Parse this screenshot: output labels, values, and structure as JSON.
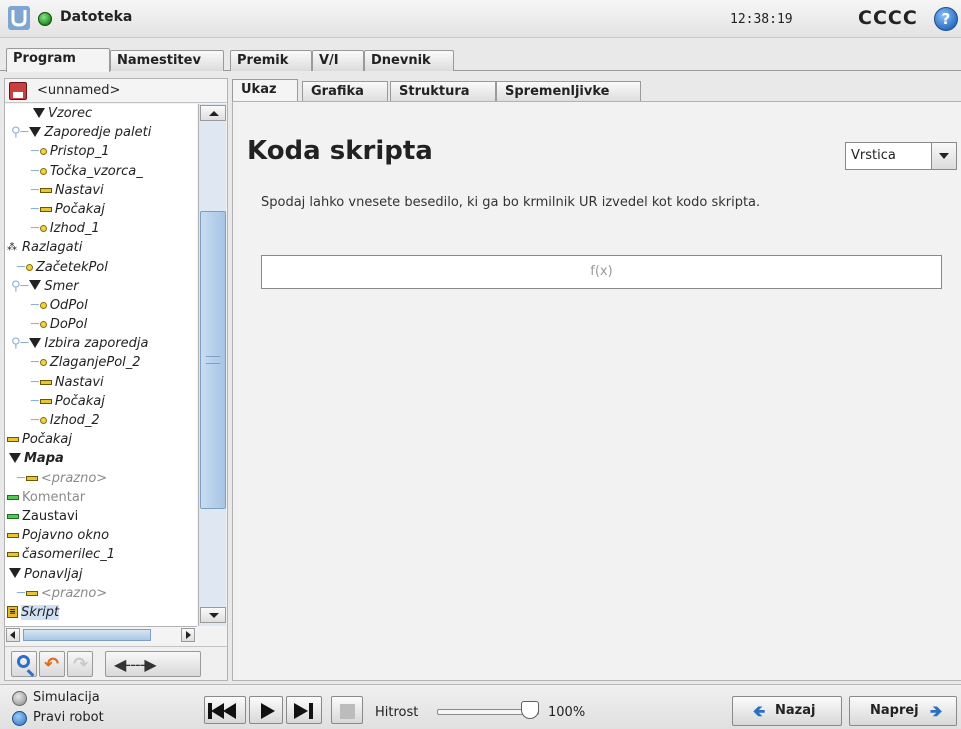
{
  "topbar": {
    "file_label": "Datoteka",
    "clock": "12:38:19",
    "robot_name": "CCCC",
    "help_glyph": "?"
  },
  "main_tabs": [
    "Program",
    "Namestitev",
    "Premik",
    "V/I",
    "Dnevnik"
  ],
  "program": {
    "name": "<unnamed>"
  },
  "tree": [
    {
      "label": "Vzorec",
      "icon": "triangle"
    },
    {
      "label": "Zaporedje paleti",
      "icon": "triangle"
    },
    {
      "label": "Pristop_1",
      "icon": "waypoint"
    },
    {
      "label": "Točka_vzorca_",
      "icon": "waypoint"
    },
    {
      "label": "Nastavi",
      "icon": "bar"
    },
    {
      "label": "Počakaj",
      "icon": "bar"
    },
    {
      "label": "Izhod_1",
      "icon": "waypoint"
    },
    {
      "label": "Razlagati",
      "icon": "pallet"
    },
    {
      "label": "ZačetekPol",
      "icon": "waypoint"
    },
    {
      "label": "Smer",
      "icon": "triangle"
    },
    {
      "label": "OdPol",
      "icon": "waypoint"
    },
    {
      "label": "DoPol",
      "icon": "waypoint"
    },
    {
      "label": "Izbira zaporedja",
      "icon": "triangle"
    },
    {
      "label": "ZlaganjePol_2",
      "icon": "waypoint"
    },
    {
      "label": "Nastavi",
      "icon": "bar"
    },
    {
      "label": "Počakaj",
      "icon": "bar"
    },
    {
      "label": "Izhod_2",
      "icon": "waypoint"
    },
    {
      "label": "Počakaj",
      "icon": "bar"
    },
    {
      "label": "Mapa",
      "icon": "triangle"
    },
    {
      "label": "<prazno>",
      "icon": "bar"
    },
    {
      "label": "Komentar",
      "icon": "bar-green"
    },
    {
      "label": "Zaustavi",
      "icon": "bar-green"
    },
    {
      "label": "Pojavno okno",
      "icon": "bar"
    },
    {
      "label": "časomerilec_1",
      "icon": "bar"
    },
    {
      "label": "Ponavljaj",
      "icon": "triangle"
    },
    {
      "label": "<prazno>",
      "icon": "bar"
    },
    {
      "label": "Skript",
      "icon": "script"
    }
  ],
  "sub_tabs": [
    "Ukaz",
    "Grafika",
    "Struktura",
    "Spremenljivke"
  ],
  "script": {
    "title": "Koda skripta",
    "mode": "Vrstica",
    "description": "Spodaj lahko vnesete besedilo, ki ga bo krmilnik UR izvedel kot kodo skripta.",
    "formula_placeholder": "f(x)"
  },
  "footer": {
    "simulation": "Simulacija",
    "real_robot": "Pravi robot",
    "speed_label": "Hitrost",
    "speed_value": "100%",
    "speed_fraction": 1.0,
    "back": "Nazaj",
    "next": "Naprej"
  },
  "colors": {
    "accent_blue": "#2b6fc2",
    "status_green": "#1f8f1f",
    "node_yellow": "#f2d14a"
  }
}
